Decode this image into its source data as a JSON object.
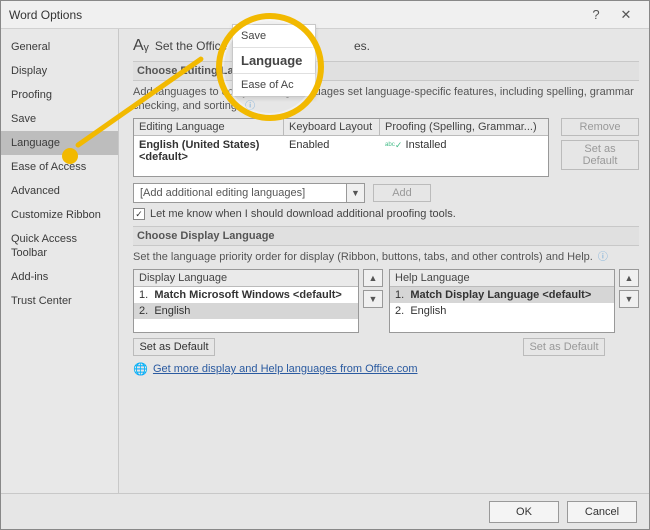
{
  "window": {
    "title": "Word Options"
  },
  "sidebar": {
    "items": [
      {
        "label": "General"
      },
      {
        "label": "Display"
      },
      {
        "label": "Proofing"
      },
      {
        "label": "Save"
      },
      {
        "label": "Language"
      },
      {
        "label": "Ease of Access"
      },
      {
        "label": "Advanced"
      },
      {
        "label": "Customize Ribbon"
      },
      {
        "label": "Quick Access Toolbar"
      },
      {
        "label": "Add-ins"
      },
      {
        "label": "Trust Center"
      }
    ],
    "selected_index": 4
  },
  "heading": {
    "text": "Set the Office",
    "suffix": "es."
  },
  "editing": {
    "group_label": "Choose Editing Lan",
    "description": "Add languages to edit yo             Editing languages set language-specific features, including spelling, grammar checking, and sorting.",
    "columns": {
      "lang": "Editing Language",
      "kbd": "Keyboard Layout",
      "proof": "Proofing (Spelling, Grammar...)"
    },
    "rows": [
      {
        "lang": "English (United States) <default>",
        "kbd": "Enabled",
        "proof": "Installed"
      }
    ],
    "remove_label": "Remove",
    "set_default_label": "Set as Default",
    "add_combo": "[Add additional editing languages]",
    "add_btn": "Add",
    "download_checked": true,
    "download_label": "Let me know when I should download additional proofing tools."
  },
  "display": {
    "group_label": "Choose Display Language",
    "description": "Set the language priority order for display (Ribbon, buttons, tabs, and other controls) and Help.",
    "display_header": "Display Language",
    "display_items": [
      {
        "idx": "1.",
        "label": "Match Microsoft Windows <default>",
        "bold": true,
        "selected": false
      },
      {
        "idx": "2.",
        "label": "English",
        "bold": false,
        "selected": true
      }
    ],
    "help_header": "Help Language",
    "help_items": [
      {
        "idx": "1.",
        "label": "Match Display Language <default>",
        "bold": true,
        "selected": true
      },
      {
        "idx": "2.",
        "label": "English",
        "bold": false,
        "selected": false
      }
    ],
    "set_default_label": "Set as Default",
    "link_text": "Get more display and Help languages from Office.com"
  },
  "highlight": {
    "menu": [
      "Save",
      "Language",
      "Ease of Ac"
    ]
  },
  "footer": {
    "ok": "OK",
    "cancel": "Cancel"
  }
}
